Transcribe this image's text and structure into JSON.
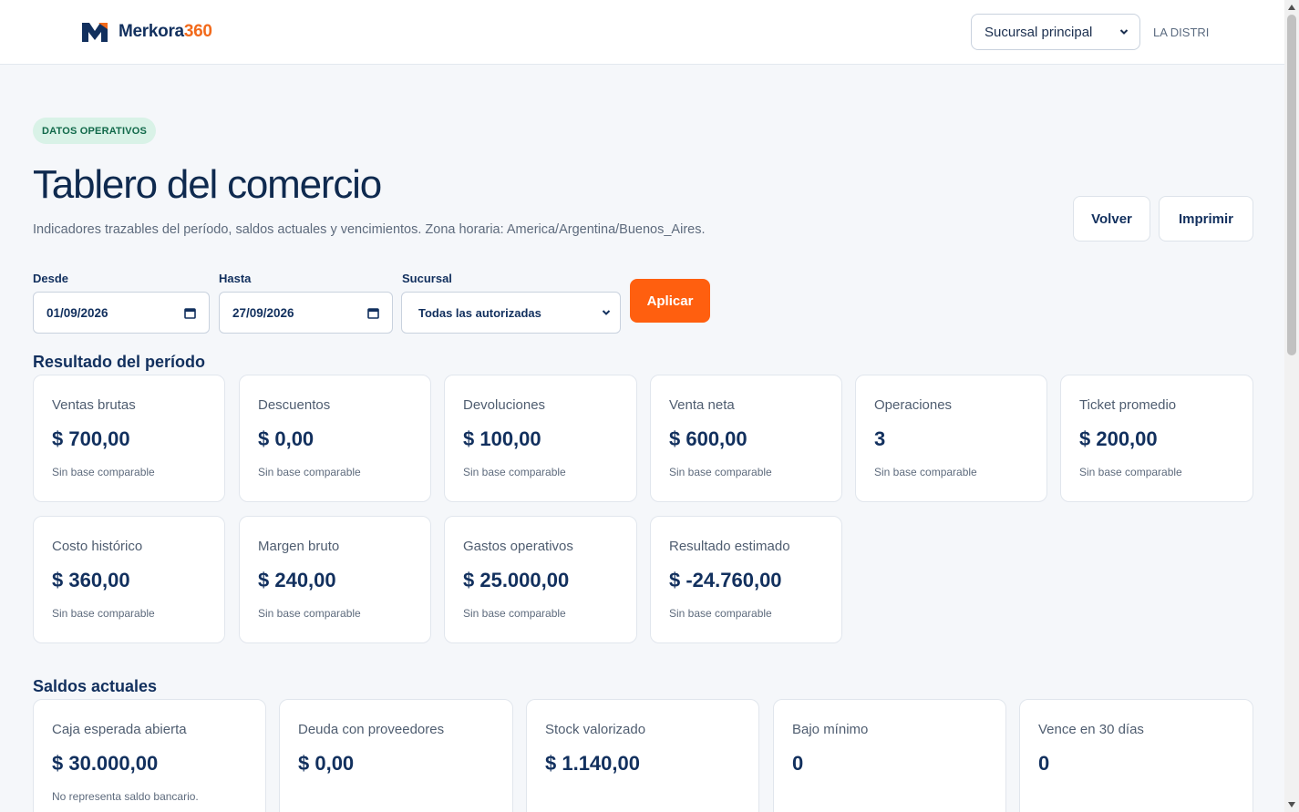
{
  "header": {
    "brand_main": "Merkora",
    "brand_accent": "360",
    "branch_select": "Sucursal principal",
    "user": "LA DISTRI"
  },
  "badge": "DATOS OPERATIVOS",
  "title": "Tablero del comercio",
  "subtitle": "Indicadores trazables del período, saldos actuales y vencimientos. Zona horaria: America/Argentina/Buenos_Aires.",
  "actions": {
    "back": "Volver",
    "print": "Imprimir"
  },
  "filters": {
    "from_label": "Desde",
    "from_value": "01/09/2026",
    "to_label": "Hasta",
    "to_value": "27/09/2026",
    "branch_label": "Sucursal",
    "branch_value": "Todas las autorizadas",
    "apply": "Aplicar"
  },
  "period": {
    "title": "Resultado del período",
    "cards": [
      {
        "label": "Ventas brutas",
        "value": "$ 700,00",
        "note": "Sin base comparable"
      },
      {
        "label": "Descuentos",
        "value": "$ 0,00",
        "note": "Sin base comparable"
      },
      {
        "label": "Devoluciones",
        "value": "$ 100,00",
        "note": "Sin base comparable"
      },
      {
        "label": "Venta neta",
        "value": "$ 600,00",
        "note": "Sin base comparable"
      },
      {
        "label": "Operaciones",
        "value": "3",
        "note": "Sin base comparable"
      },
      {
        "label": "Ticket promedio",
        "value": "$ 200,00",
        "note": "Sin base comparable"
      },
      {
        "label": "Costo histórico",
        "value": "$ 360,00",
        "note": "Sin base comparable"
      },
      {
        "label": "Margen bruto",
        "value": "$ 240,00",
        "note": "Sin base comparable"
      },
      {
        "label": "Gastos operativos",
        "value": "$ 25.000,00",
        "note": "Sin base comparable"
      },
      {
        "label": "Resultado estimado",
        "value": "$ -24.760,00",
        "note": "Sin base comparable"
      }
    ]
  },
  "balances": {
    "title": "Saldos actuales",
    "cards": [
      {
        "label": "Caja esperada abierta",
        "value": "$ 30.000,00",
        "note": "No representa saldo bancario."
      },
      {
        "label": "Deuda con proveedores",
        "value": "$ 0,00"
      },
      {
        "label": "Stock valorizado",
        "value": "$ 1.140,00"
      },
      {
        "label": "Bajo mínimo",
        "value": "0"
      },
      {
        "label": "Vence en 30 días",
        "value": "0"
      }
    ]
  },
  "colors": {
    "brand": "#12305e",
    "accent": "#ff5f0f",
    "badge_bg": "#d9f2e7",
    "badge_text": "#11694a"
  }
}
